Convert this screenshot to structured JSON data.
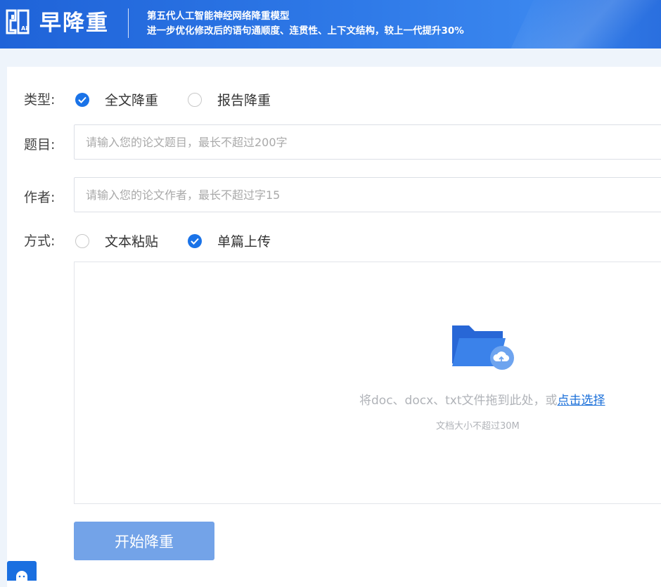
{
  "header": {
    "brand": "早降重",
    "tagline_line1": "第五代人工智能神经网络降重模型",
    "tagline_line2": "进一步优化修改后的语句通顺度、连贯性、上下文结构，较上一代提升30%"
  },
  "form": {
    "type_label": "类型:",
    "type_options": [
      {
        "label": "全文降重",
        "checked": true
      },
      {
        "label": "报告降重",
        "checked": false
      }
    ],
    "title_label": "题目:",
    "title_placeholder": "请输入您的论文题目，最长不超过200字",
    "author_label": "作者:",
    "author_placeholder": "请输入您的论文作者，最长不超过字15",
    "method_label": "方式:",
    "method_options": [
      {
        "label": "文本粘贴",
        "checked": false
      },
      {
        "label": "单篇上传",
        "checked": true
      }
    ]
  },
  "upload": {
    "hint_prefix": "将doc、docx、txt文件拖到此处，或",
    "hint_link": "点击选择",
    "size_limit": "文档大小不超过30M"
  },
  "start_button": "开始降重",
  "colors": {
    "header_blue": "#2f7ae8",
    "accent": "#1a73e8",
    "button": "#73a3e8"
  }
}
